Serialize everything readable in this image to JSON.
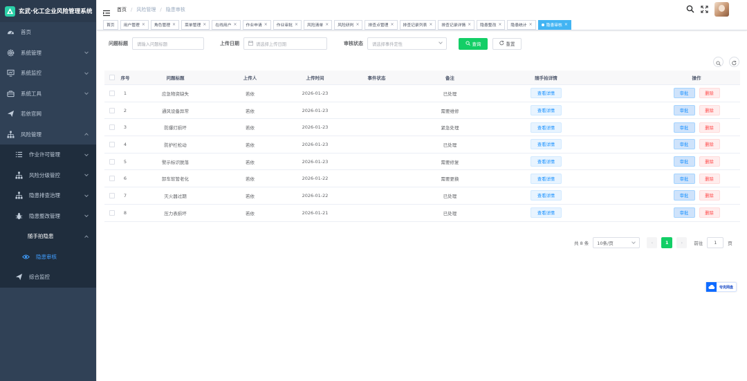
{
  "app": {
    "title": "玄武·化工企业风险管理系统"
  },
  "sidebar": {
    "items": [
      {
        "label": "首页",
        "icon": "dashboard-icon"
      },
      {
        "label": "系统管理",
        "icon": "gear-icon"
      },
      {
        "label": "系统监控",
        "icon": "monitor-icon"
      },
      {
        "label": "系统工具",
        "icon": "toolbox-icon"
      },
      {
        "label": "若依官网",
        "icon": "send-icon"
      },
      {
        "label": "风险管理",
        "icon": "tree-icon"
      }
    ],
    "risk_sub": [
      {
        "label": "作业许可管理",
        "icon": "list-icon"
      },
      {
        "label": "风险分级管控",
        "icon": "tree-icon"
      },
      {
        "label": "隐患排查治理",
        "icon": "tree-icon"
      },
      {
        "label": "隐患整改管理",
        "icon": "bug-icon"
      }
    ],
    "photo_group": {
      "label": "随手拍隐患"
    },
    "photo_active": {
      "label": "隐患审核",
      "icon": "eye-icon"
    },
    "monitor": {
      "label": "综合监控",
      "icon": "send-icon"
    }
  },
  "breadcrumb": [
    "首页",
    "风险管理",
    "隐患审核"
  ],
  "tags": [
    {
      "label": "首页",
      "closable": false
    },
    {
      "label": "用户管理",
      "closable": true
    },
    {
      "label": "角色管理",
      "closable": true
    },
    {
      "label": "菜单管理",
      "closable": true
    },
    {
      "label": "在线用户",
      "closable": true
    },
    {
      "label": "作业申请",
      "closable": true
    },
    {
      "label": "作业审批",
      "closable": true
    },
    {
      "label": "风险清单",
      "closable": true
    },
    {
      "label": "风险研判",
      "closable": true
    },
    {
      "label": "排查点管理",
      "closable": true
    },
    {
      "label": "排查记录列表",
      "closable": true
    },
    {
      "label": "排查记录详情",
      "closable": true
    },
    {
      "label": "隐患整改",
      "closable": true
    },
    {
      "label": "隐患统计",
      "closable": true
    },
    {
      "label": "隐患审核",
      "closable": true,
      "active": true
    }
  ],
  "search": {
    "title_label": "问题标题",
    "title_placeholder": "请输入问题标题",
    "date_label": "上传日期",
    "date_placeholder": "请选择上传日期",
    "status_label": "审核状态",
    "status_placeholder": "请选择事件定性",
    "query_button": "查询",
    "reset_button": "重置"
  },
  "table": {
    "headers": [
      "序号",
      "问题标题",
      "上传人",
      "上传时间",
      "事件状态",
      "备注",
      "随手拍详情",
      "操作"
    ],
    "detail_button": "查看详情",
    "approve_button": "审批",
    "delete_button": "删除",
    "rows": [
      {
        "no": "1",
        "title": "应急物资缺失",
        "uploader": "若依",
        "time": "2026-01-23",
        "status": "",
        "remark": "已处理"
      },
      {
        "no": "2",
        "title": "通风设备异常",
        "uploader": "若依",
        "time": "2026-01-23",
        "status": "",
        "remark": "需要维修"
      },
      {
        "no": "3",
        "title": "防爆灯损坏",
        "uploader": "若依",
        "time": "2026-01-23",
        "status": "",
        "remark": "紧急处理"
      },
      {
        "no": "4",
        "title": "防护栏松动",
        "uploader": "若依",
        "time": "2026-01-23",
        "status": "",
        "remark": "已处理"
      },
      {
        "no": "5",
        "title": "警示标识脱落",
        "uploader": "若依",
        "time": "2026-01-23",
        "status": "",
        "remark": "需要修复"
      },
      {
        "no": "6",
        "title": "卸车软管老化",
        "uploader": "若依",
        "time": "2026-01-22",
        "status": "",
        "remark": "需要更换"
      },
      {
        "no": "7",
        "title": "灭火器过期",
        "uploader": "若依",
        "time": "2026-01-22",
        "status": "",
        "remark": "已处理"
      },
      {
        "no": "8",
        "title": "压力表损坏",
        "uploader": "若依",
        "time": "2026-01-21",
        "status": "",
        "remark": "已处理"
      }
    ]
  },
  "pagination": {
    "total_text": "共 8 条",
    "page_size": "10条/页",
    "current_page": "1",
    "goto_label": "前往",
    "goto_value": "1",
    "page_unit": "页"
  },
  "cloud": {
    "label": "夸克网盘"
  },
  "colors": {
    "sidebar": "#304156",
    "accent": "#13ce66",
    "active_tag": "#42b4f3",
    "primary": "#1890ff"
  }
}
